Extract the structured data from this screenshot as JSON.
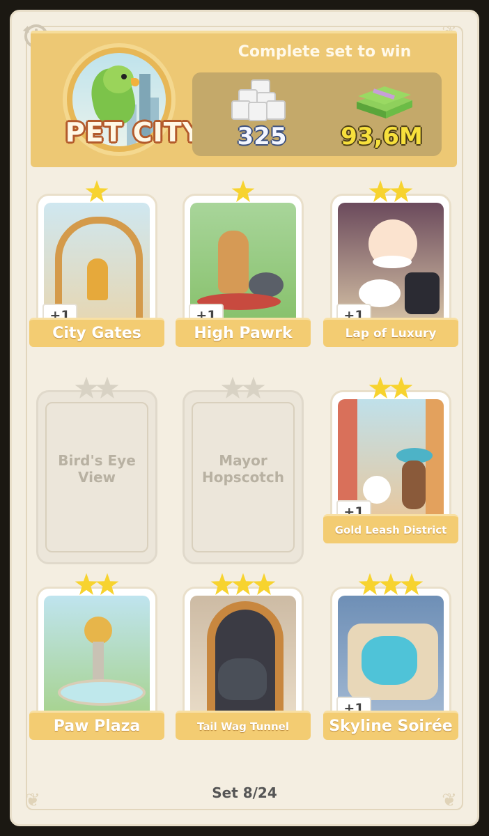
{
  "header": {
    "album_name": "PET CITY",
    "reward_title": "Complete set to win",
    "dice_reward": "325",
    "cash_reward": "93,6M"
  },
  "cards": [
    {
      "name": "City Gates",
      "stars": 1,
      "plus": "+1",
      "collected": true
    },
    {
      "name": "High Pawrk",
      "stars": 1,
      "plus": "+1",
      "collected": true
    },
    {
      "name": "Lap of Luxury",
      "stars": 2,
      "plus": "+1",
      "collected": true
    },
    {
      "name": "Bird's Eye View",
      "stars": 2,
      "collected": false
    },
    {
      "name": "Mayor Hopscotch",
      "stars": 2,
      "collected": false
    },
    {
      "name": "Gold Leash District",
      "stars": 2,
      "plus": "+1",
      "collected": true
    },
    {
      "name": "Paw Plaza",
      "stars": 2,
      "collected": true
    },
    {
      "name": "Tail Wag Tunnel",
      "stars": 3,
      "collected": true
    },
    {
      "name": "Skyline Soirée",
      "stars": 3,
      "plus": "+1",
      "collected": true
    }
  ],
  "footer": {
    "set_counter": "Set 8/24"
  },
  "colors": {
    "gold": "#edc874",
    "star": "#f7d32f",
    "panel": "#f4eee1"
  }
}
